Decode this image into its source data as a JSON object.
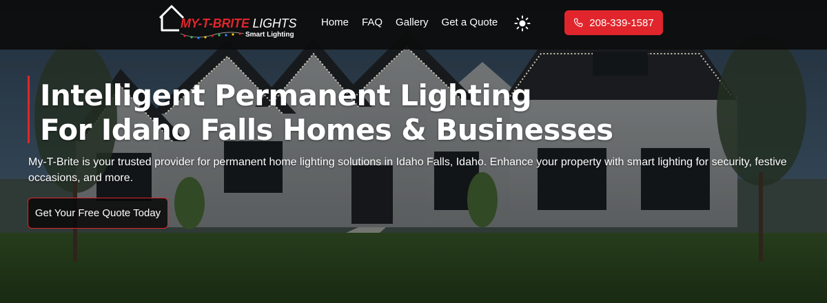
{
  "brand": {
    "name": "MY-T-BRITE",
    "name_suffix": "LIGHTS",
    "tagline": "Smart Lighting",
    "accent_color": "#e0262c"
  },
  "nav": {
    "links": [
      "Home",
      "FAQ",
      "Gallery",
      "Get a Quote"
    ],
    "theme_toggle_icon": "sun-icon",
    "phone": {
      "label": "208-339-1587",
      "icon": "phone-icon"
    }
  },
  "hero": {
    "title_line1": "Intelligent Permanent Lighting",
    "title_line2": "For Idaho Falls Homes & Businesses",
    "description": "My-T-Brite is your trusted provider for permanent home lighting solutions in Idaho Falls, Idaho. Enhance your property with smart lighting for security, festive occasions, and more.",
    "cta_label": "Get Your Free Quote Today",
    "background_image": "house-at-dusk-with-roofline-lights"
  }
}
